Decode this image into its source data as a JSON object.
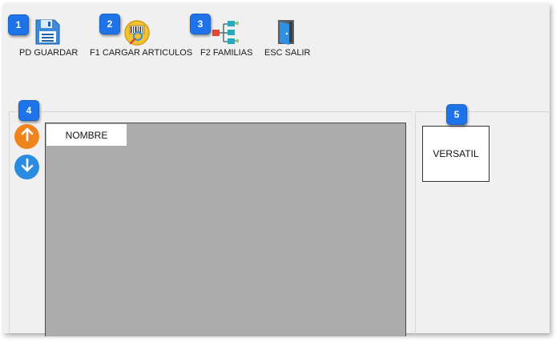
{
  "toolbar": {
    "save_label": "PD GUARDAR",
    "load_label": "F1 CARGAR ARTICULOS",
    "families_label": "F2 FAMILIAS",
    "exit_label": "ESC SALIR"
  },
  "icons": {
    "save": "floppy-disk-icon",
    "load": "barcode-scanner-icon",
    "families": "hierarchy-tree-icon",
    "exit": "exit-door-icon",
    "up": "arrow-up-icon",
    "down": "arrow-down-icon"
  },
  "badges": [
    "1",
    "2",
    "3",
    "4",
    "5"
  ],
  "grid": {
    "columns": [
      "NOMBRE"
    ]
  },
  "families": {
    "items": [
      "VERSATIL"
    ]
  },
  "colors": {
    "badge": "#1e73e8",
    "up_button": "#f0841c",
    "down_button": "#2a8be0",
    "grid_background": "#ababab"
  }
}
